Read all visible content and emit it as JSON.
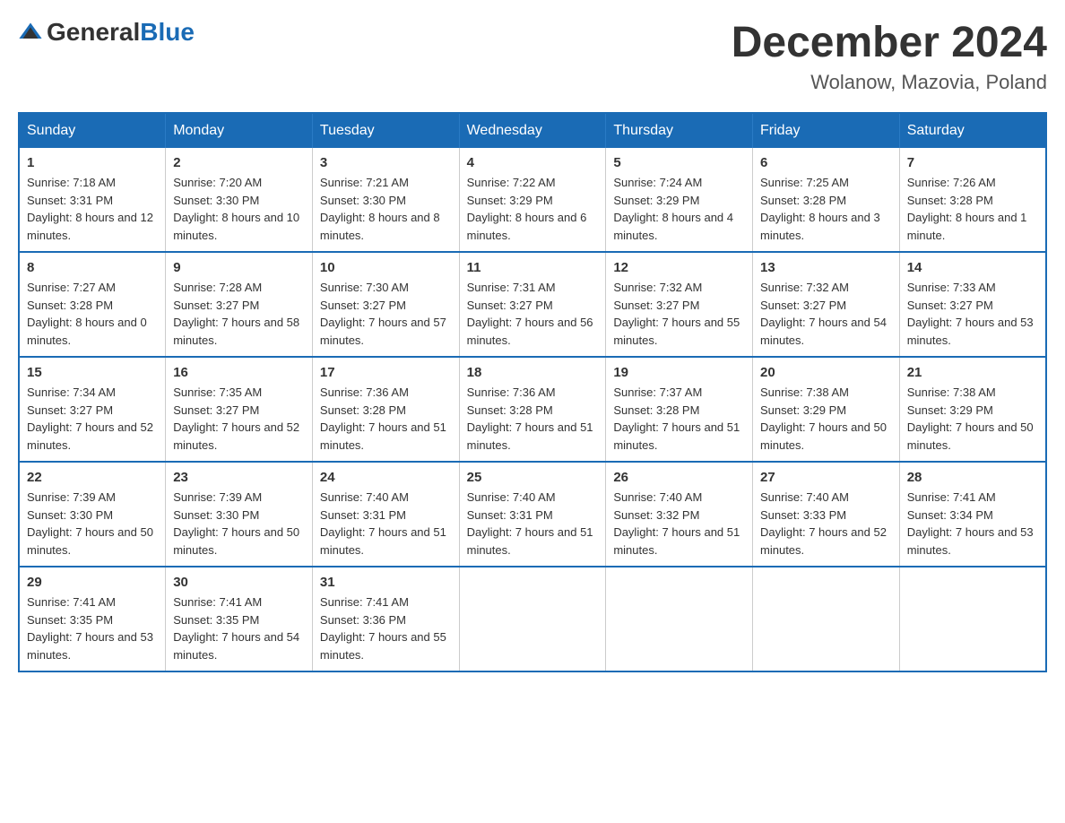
{
  "header": {
    "logo": {
      "general": "General",
      "blue": "Blue"
    },
    "title": "December 2024",
    "location": "Wolanow, Mazovia, Poland"
  },
  "calendar": {
    "headers": [
      "Sunday",
      "Monday",
      "Tuesday",
      "Wednesday",
      "Thursday",
      "Friday",
      "Saturday"
    ],
    "weeks": [
      [
        {
          "day": "1",
          "sunrise": "7:18 AM",
          "sunset": "3:31 PM",
          "daylight": "8 hours and 12 minutes."
        },
        {
          "day": "2",
          "sunrise": "7:20 AM",
          "sunset": "3:30 PM",
          "daylight": "8 hours and 10 minutes."
        },
        {
          "day": "3",
          "sunrise": "7:21 AM",
          "sunset": "3:30 PM",
          "daylight": "8 hours and 8 minutes."
        },
        {
          "day": "4",
          "sunrise": "7:22 AM",
          "sunset": "3:29 PM",
          "daylight": "8 hours and 6 minutes."
        },
        {
          "day": "5",
          "sunrise": "7:24 AM",
          "sunset": "3:29 PM",
          "daylight": "8 hours and 4 minutes."
        },
        {
          "day": "6",
          "sunrise": "7:25 AM",
          "sunset": "3:28 PM",
          "daylight": "8 hours and 3 minutes."
        },
        {
          "day": "7",
          "sunrise": "7:26 AM",
          "sunset": "3:28 PM",
          "daylight": "8 hours and 1 minute."
        }
      ],
      [
        {
          "day": "8",
          "sunrise": "7:27 AM",
          "sunset": "3:28 PM",
          "daylight": "8 hours and 0 minutes."
        },
        {
          "day": "9",
          "sunrise": "7:28 AM",
          "sunset": "3:27 PM",
          "daylight": "7 hours and 58 minutes."
        },
        {
          "day": "10",
          "sunrise": "7:30 AM",
          "sunset": "3:27 PM",
          "daylight": "7 hours and 57 minutes."
        },
        {
          "day": "11",
          "sunrise": "7:31 AM",
          "sunset": "3:27 PM",
          "daylight": "7 hours and 56 minutes."
        },
        {
          "day": "12",
          "sunrise": "7:32 AM",
          "sunset": "3:27 PM",
          "daylight": "7 hours and 55 minutes."
        },
        {
          "day": "13",
          "sunrise": "7:32 AM",
          "sunset": "3:27 PM",
          "daylight": "7 hours and 54 minutes."
        },
        {
          "day": "14",
          "sunrise": "7:33 AM",
          "sunset": "3:27 PM",
          "daylight": "7 hours and 53 minutes."
        }
      ],
      [
        {
          "day": "15",
          "sunrise": "7:34 AM",
          "sunset": "3:27 PM",
          "daylight": "7 hours and 52 minutes."
        },
        {
          "day": "16",
          "sunrise": "7:35 AM",
          "sunset": "3:27 PM",
          "daylight": "7 hours and 52 minutes."
        },
        {
          "day": "17",
          "sunrise": "7:36 AM",
          "sunset": "3:28 PM",
          "daylight": "7 hours and 51 minutes."
        },
        {
          "day": "18",
          "sunrise": "7:36 AM",
          "sunset": "3:28 PM",
          "daylight": "7 hours and 51 minutes."
        },
        {
          "day": "19",
          "sunrise": "7:37 AM",
          "sunset": "3:28 PM",
          "daylight": "7 hours and 51 minutes."
        },
        {
          "day": "20",
          "sunrise": "7:38 AM",
          "sunset": "3:29 PM",
          "daylight": "7 hours and 50 minutes."
        },
        {
          "day": "21",
          "sunrise": "7:38 AM",
          "sunset": "3:29 PM",
          "daylight": "7 hours and 50 minutes."
        }
      ],
      [
        {
          "day": "22",
          "sunrise": "7:39 AM",
          "sunset": "3:30 PM",
          "daylight": "7 hours and 50 minutes."
        },
        {
          "day": "23",
          "sunrise": "7:39 AM",
          "sunset": "3:30 PM",
          "daylight": "7 hours and 50 minutes."
        },
        {
          "day": "24",
          "sunrise": "7:40 AM",
          "sunset": "3:31 PM",
          "daylight": "7 hours and 51 minutes."
        },
        {
          "day": "25",
          "sunrise": "7:40 AM",
          "sunset": "3:31 PM",
          "daylight": "7 hours and 51 minutes."
        },
        {
          "day": "26",
          "sunrise": "7:40 AM",
          "sunset": "3:32 PM",
          "daylight": "7 hours and 51 minutes."
        },
        {
          "day": "27",
          "sunrise": "7:40 AM",
          "sunset": "3:33 PM",
          "daylight": "7 hours and 52 minutes."
        },
        {
          "day": "28",
          "sunrise": "7:41 AM",
          "sunset": "3:34 PM",
          "daylight": "7 hours and 53 minutes."
        }
      ],
      [
        {
          "day": "29",
          "sunrise": "7:41 AM",
          "sunset": "3:35 PM",
          "daylight": "7 hours and 53 minutes."
        },
        {
          "day": "30",
          "sunrise": "7:41 AM",
          "sunset": "3:35 PM",
          "daylight": "7 hours and 54 minutes."
        },
        {
          "day": "31",
          "sunrise": "7:41 AM",
          "sunset": "3:36 PM",
          "daylight": "7 hours and 55 minutes."
        },
        null,
        null,
        null,
        null
      ]
    ]
  }
}
